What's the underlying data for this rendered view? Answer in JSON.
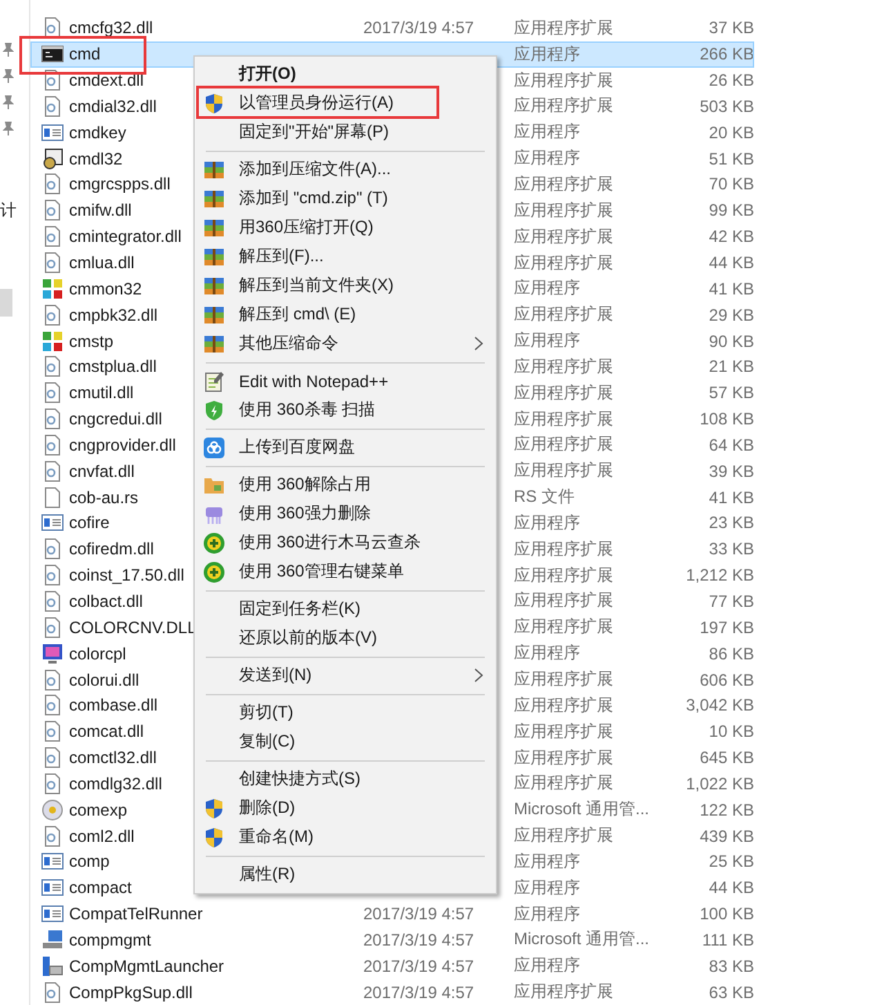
{
  "nav_pane": {
    "label": "计"
  },
  "files": [
    {
      "name": "cmcfg32.dll",
      "kind": "dll",
      "date": "2017/3/19 4:57",
      "type": "应用程序扩展",
      "size": "37 KB",
      "selected": false
    },
    {
      "name": "cmd",
      "kind": "console",
      "type": "应用程序",
      "size": "266 KB",
      "selected": true
    },
    {
      "name": "cmdext.dll",
      "kind": "dll",
      "type": "应用程序扩展",
      "size": "26 KB",
      "selected": false
    },
    {
      "name": "cmdial32.dll",
      "kind": "dll",
      "type": "应用程序扩展",
      "size": "503 KB",
      "selected": false
    },
    {
      "name": "cmdkey",
      "kind": "app",
      "type": "应用程序",
      "size": "20 KB",
      "selected": false
    },
    {
      "name": "cmdl32",
      "kind": "install",
      "type": "应用程序",
      "size": "51 KB",
      "selected": false
    },
    {
      "name": "cmgrcspps.dll",
      "kind": "dll",
      "type": "应用程序扩展",
      "size": "70 KB",
      "selected": false
    },
    {
      "name": "cmifw.dll",
      "kind": "dll",
      "type": "应用程序扩展",
      "size": "99 KB",
      "selected": false
    },
    {
      "name": "cmintegrator.dll",
      "kind": "dll",
      "type": "应用程序扩展",
      "size": "42 KB",
      "selected": false
    },
    {
      "name": "cmlua.dll",
      "kind": "dll",
      "type": "应用程序扩展",
      "size": "44 KB",
      "selected": false
    },
    {
      "name": "cmmon32",
      "kind": "connect",
      "type": "应用程序",
      "size": "41 KB",
      "selected": false
    },
    {
      "name": "cmpbk32.dll",
      "kind": "dll",
      "type": "应用程序扩展",
      "size": "29 KB",
      "selected": false
    },
    {
      "name": "cmstp",
      "kind": "connect",
      "type": "应用程序",
      "size": "90 KB",
      "selected": false
    },
    {
      "name": "cmstplua.dll",
      "kind": "dll",
      "type": "应用程序扩展",
      "size": "21 KB",
      "selected": false
    },
    {
      "name": "cmutil.dll",
      "kind": "dll",
      "type": "应用程序扩展",
      "size": "57 KB",
      "selected": false
    },
    {
      "name": "cngcredui.dll",
      "kind": "dll",
      "type": "应用程序扩展",
      "size": "108 KB",
      "selected": false
    },
    {
      "name": "cngprovider.dll",
      "kind": "dll",
      "type": "应用程序扩展",
      "size": "64 KB",
      "selected": false
    },
    {
      "name": "cnvfat.dll",
      "kind": "dll",
      "type": "应用程序扩展",
      "size": "39 KB",
      "selected": false
    },
    {
      "name": "cob-au.rs",
      "kind": "blank",
      "type": "RS 文件",
      "size": "41 KB",
      "selected": false
    },
    {
      "name": "cofire",
      "kind": "app",
      "type": "应用程序",
      "size": "23 KB",
      "selected": false
    },
    {
      "name": "cofiredm.dll",
      "kind": "dll",
      "type": "应用程序扩展",
      "size": "33 KB",
      "selected": false
    },
    {
      "name": "coinst_17.50.dll",
      "kind": "dll",
      "type": "应用程序扩展",
      "size": "1,212 KB",
      "selected": false
    },
    {
      "name": "colbact.dll",
      "kind": "dll",
      "type": "应用程序扩展",
      "size": "77 KB",
      "selected": false
    },
    {
      "name": "COLORCNV.DLL",
      "kind": "dll",
      "type": "应用程序扩展",
      "size": "197 KB",
      "selected": false
    },
    {
      "name": "colorcpl",
      "kind": "monitor",
      "type": "应用程序",
      "size": "86 KB",
      "selected": false
    },
    {
      "name": "colorui.dll",
      "kind": "dll",
      "type": "应用程序扩展",
      "size": "606 KB",
      "selected": false
    },
    {
      "name": "combase.dll",
      "kind": "dll",
      "type": "应用程序扩展",
      "size": "3,042 KB",
      "selected": false
    },
    {
      "name": "comcat.dll",
      "kind": "dll",
      "type": "应用程序扩展",
      "size": "10 KB",
      "selected": false
    },
    {
      "name": "comctl32.dll",
      "kind": "dll",
      "type": "应用程序扩展",
      "size": "645 KB",
      "selected": false
    },
    {
      "name": "comdlg32.dll",
      "kind": "dll",
      "type": "应用程序扩展",
      "size": "1,022 KB",
      "selected": false
    },
    {
      "name": "comexp",
      "kind": "disc",
      "type": "Microsoft 通用管...",
      "size": "122 KB",
      "selected": false
    },
    {
      "name": "coml2.dll",
      "kind": "dll",
      "type": "应用程序扩展",
      "size": "439 KB",
      "selected": false
    },
    {
      "name": "comp",
      "kind": "app",
      "type": "应用程序",
      "size": "25 KB",
      "selected": false
    },
    {
      "name": "compact",
      "kind": "app",
      "type": "应用程序",
      "size": "44 KB",
      "selected": false
    },
    {
      "name": "CompatTelRunner",
      "kind": "app",
      "date": "2017/3/19 4:57",
      "type": "应用程序",
      "size": "100 KB",
      "selected": false
    },
    {
      "name": "compmgmt",
      "kind": "mgmt",
      "date": "2017/3/19 4:57",
      "type": "Microsoft 通用管...",
      "size": "111 KB",
      "selected": false
    },
    {
      "name": "CompMgmtLauncher",
      "kind": "launcher",
      "date": "2017/3/19 4:57",
      "type": "应用程序",
      "size": "83 KB",
      "selected": false
    },
    {
      "name": "CompPkgSup.dll",
      "kind": "dll",
      "date": "2017/3/19 4:57",
      "type": "应用程序扩展",
      "size": "63 KB",
      "selected": false
    }
  ],
  "context_menu": [
    {
      "kind": "plain",
      "label": "打开(O)",
      "bold": true
    },
    {
      "kind": "shield",
      "label": "以管理员身份运行(A)",
      "highlighted": true
    },
    {
      "kind": "plain",
      "label": "固定到\"开始\"屏幕(P)"
    },
    {
      "kind": "separator"
    },
    {
      "kind": "archive",
      "label": "添加到压缩文件(A)..."
    },
    {
      "kind": "archive",
      "label": "添加到 \"cmd.zip\" (T)"
    },
    {
      "kind": "archive",
      "label": "用360压缩打开(Q)"
    },
    {
      "kind": "archive",
      "label": "解压到(F)..."
    },
    {
      "kind": "archive",
      "label": "解压到当前文件夹(X)"
    },
    {
      "kind": "archive",
      "label": "解压到 cmd\\ (E)"
    },
    {
      "kind": "archive",
      "label": "其他压缩命令",
      "submenu": true
    },
    {
      "kind": "separator"
    },
    {
      "kind": "notepad",
      "label": "Edit with Notepad++"
    },
    {
      "kind": "guard",
      "label": "使用 360杀毒 扫描"
    },
    {
      "kind": "separator"
    },
    {
      "kind": "cloud",
      "label": "上传到百度网盘"
    },
    {
      "kind": "separator"
    },
    {
      "kind": "folder",
      "label": "使用 360解除占用"
    },
    {
      "kind": "shredder",
      "label": "使用 360强力删除"
    },
    {
      "kind": "plus",
      "label": "使用 360进行木马云查杀"
    },
    {
      "kind": "plus",
      "label": "使用 360管理右键菜单"
    },
    {
      "kind": "separator"
    },
    {
      "kind": "plain",
      "label": "固定到任务栏(K)"
    },
    {
      "kind": "plain",
      "label": "还原以前的版本(V)"
    },
    {
      "kind": "separator"
    },
    {
      "kind": "plain",
      "label": "发送到(N)",
      "submenu": true
    },
    {
      "kind": "separator"
    },
    {
      "kind": "plain",
      "label": "剪切(T)"
    },
    {
      "kind": "plain",
      "label": "复制(C)"
    },
    {
      "kind": "separator"
    },
    {
      "kind": "plain",
      "label": "创建快捷方式(S)"
    },
    {
      "kind": "shield",
      "label": "删除(D)"
    },
    {
      "kind": "shield",
      "label": "重命名(M)"
    },
    {
      "kind": "separator"
    },
    {
      "kind": "plain",
      "label": "属性(R)"
    }
  ]
}
